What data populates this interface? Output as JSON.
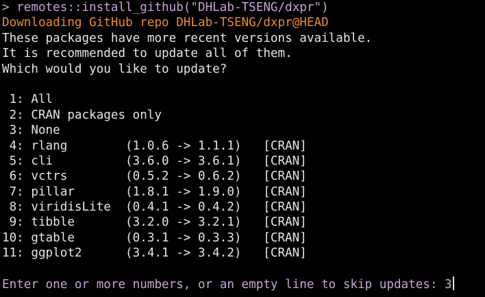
{
  "command_line": "> remotes::install_github(\"DHLab-TSENG/dxpr\")",
  "downloading": "Downloading GitHub repo DHLab-TSENG/dxpr@HEAD",
  "messages": [
    "These packages have more recent versions available.",
    "It is recommended to update all of them.",
    "Which would you like to update?"
  ],
  "options": [
    {
      "num": " 1:",
      "text": "All"
    },
    {
      "num": " 2:",
      "text": "CRAN packages only"
    },
    {
      "num": " 3:",
      "text": "None"
    }
  ],
  "packages": [
    {
      "num": " 4:",
      "name": "rlang",
      "versions": "(1.0.6 -> 1.1.1)",
      "source": "[CRAN]"
    },
    {
      "num": " 5:",
      "name": "cli",
      "versions": "(3.6.0 -> 3.6.1)",
      "source": "[CRAN]"
    },
    {
      "num": " 6:",
      "name": "vctrs",
      "versions": "(0.5.2 -> 0.6.2)",
      "source": "[CRAN]"
    },
    {
      "num": " 7:",
      "name": "pillar",
      "versions": "(1.8.1 -> 1.9.0)",
      "source": "[CRAN]"
    },
    {
      "num": " 8:",
      "name": "viridisLite",
      "versions": "(0.4.1 -> 0.4.2)",
      "source": "[CRAN]"
    },
    {
      "num": " 9:",
      "name": "tibble",
      "versions": "(3.2.0 -> 3.2.1)",
      "source": "[CRAN]"
    },
    {
      "num": "10:",
      "name": "gtable",
      "versions": "(0.3.1 -> 0.3.3)",
      "source": "[CRAN]"
    },
    {
      "num": "11:",
      "name": "ggplot2",
      "versions": "(3.4.1 -> 3.4.2)",
      "source": "[CRAN]"
    }
  ],
  "input_prompt": "Enter one or more numbers, or an empty line to skip updates: ",
  "input_value": "3",
  "colors": {
    "background": "#000000",
    "command": "#c9a3d9",
    "download": "#f28c1e",
    "text": "#e6e6e6"
  }
}
